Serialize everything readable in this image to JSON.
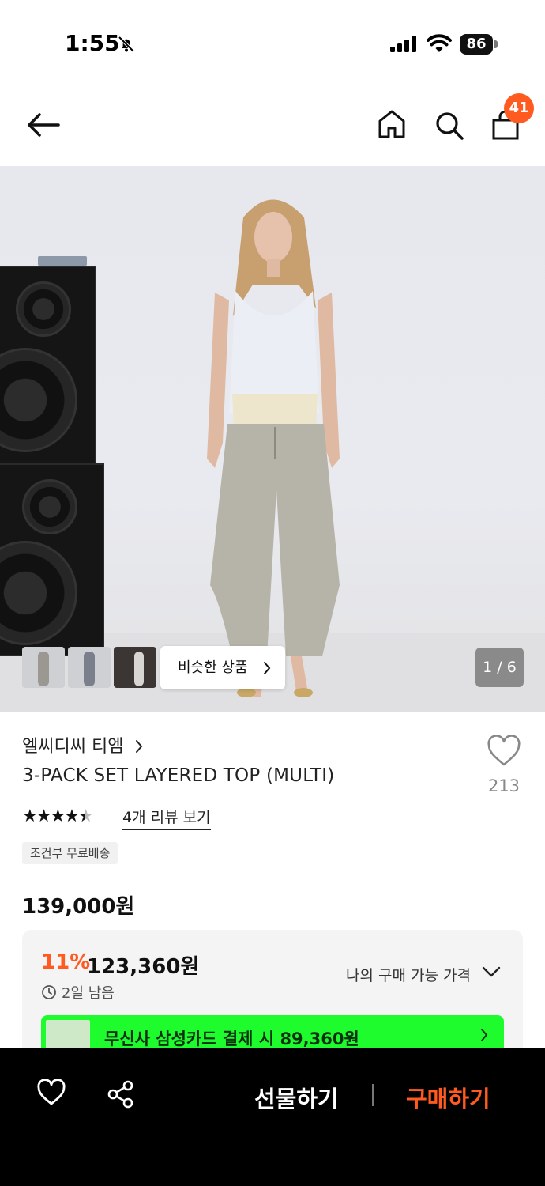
{
  "status_bar": {
    "time": "1:55",
    "battery": "86"
  },
  "nav": {
    "cart_count": "41"
  },
  "hero": {
    "similar_label": "비슷한 상품",
    "counter": "1 / 6"
  },
  "product": {
    "brand": "엘씨디씨 티엠",
    "title": "3-PACK SET LAYERED TOP (MULTI)",
    "like_count": "213",
    "rating_stars": 4.5,
    "review_link": "4개 리뷰 보기",
    "shipping_tag": "조건부 무료배송",
    "price": "139,000원"
  },
  "discount": {
    "percent": "11%",
    "sale_price": "123,360원",
    "remaining": "2일 남음",
    "my_price_label": "나의 구매 가능 가격",
    "card_promo": "무신사 삼성카드 결제 시 89,360원"
  },
  "bottom_bar": {
    "gift_label": "선물하기",
    "buy_label": "구매하기"
  },
  "colors": {
    "accent": "#ff5a1f",
    "promo_green": "#1efc2d",
    "bar": "#000000"
  }
}
